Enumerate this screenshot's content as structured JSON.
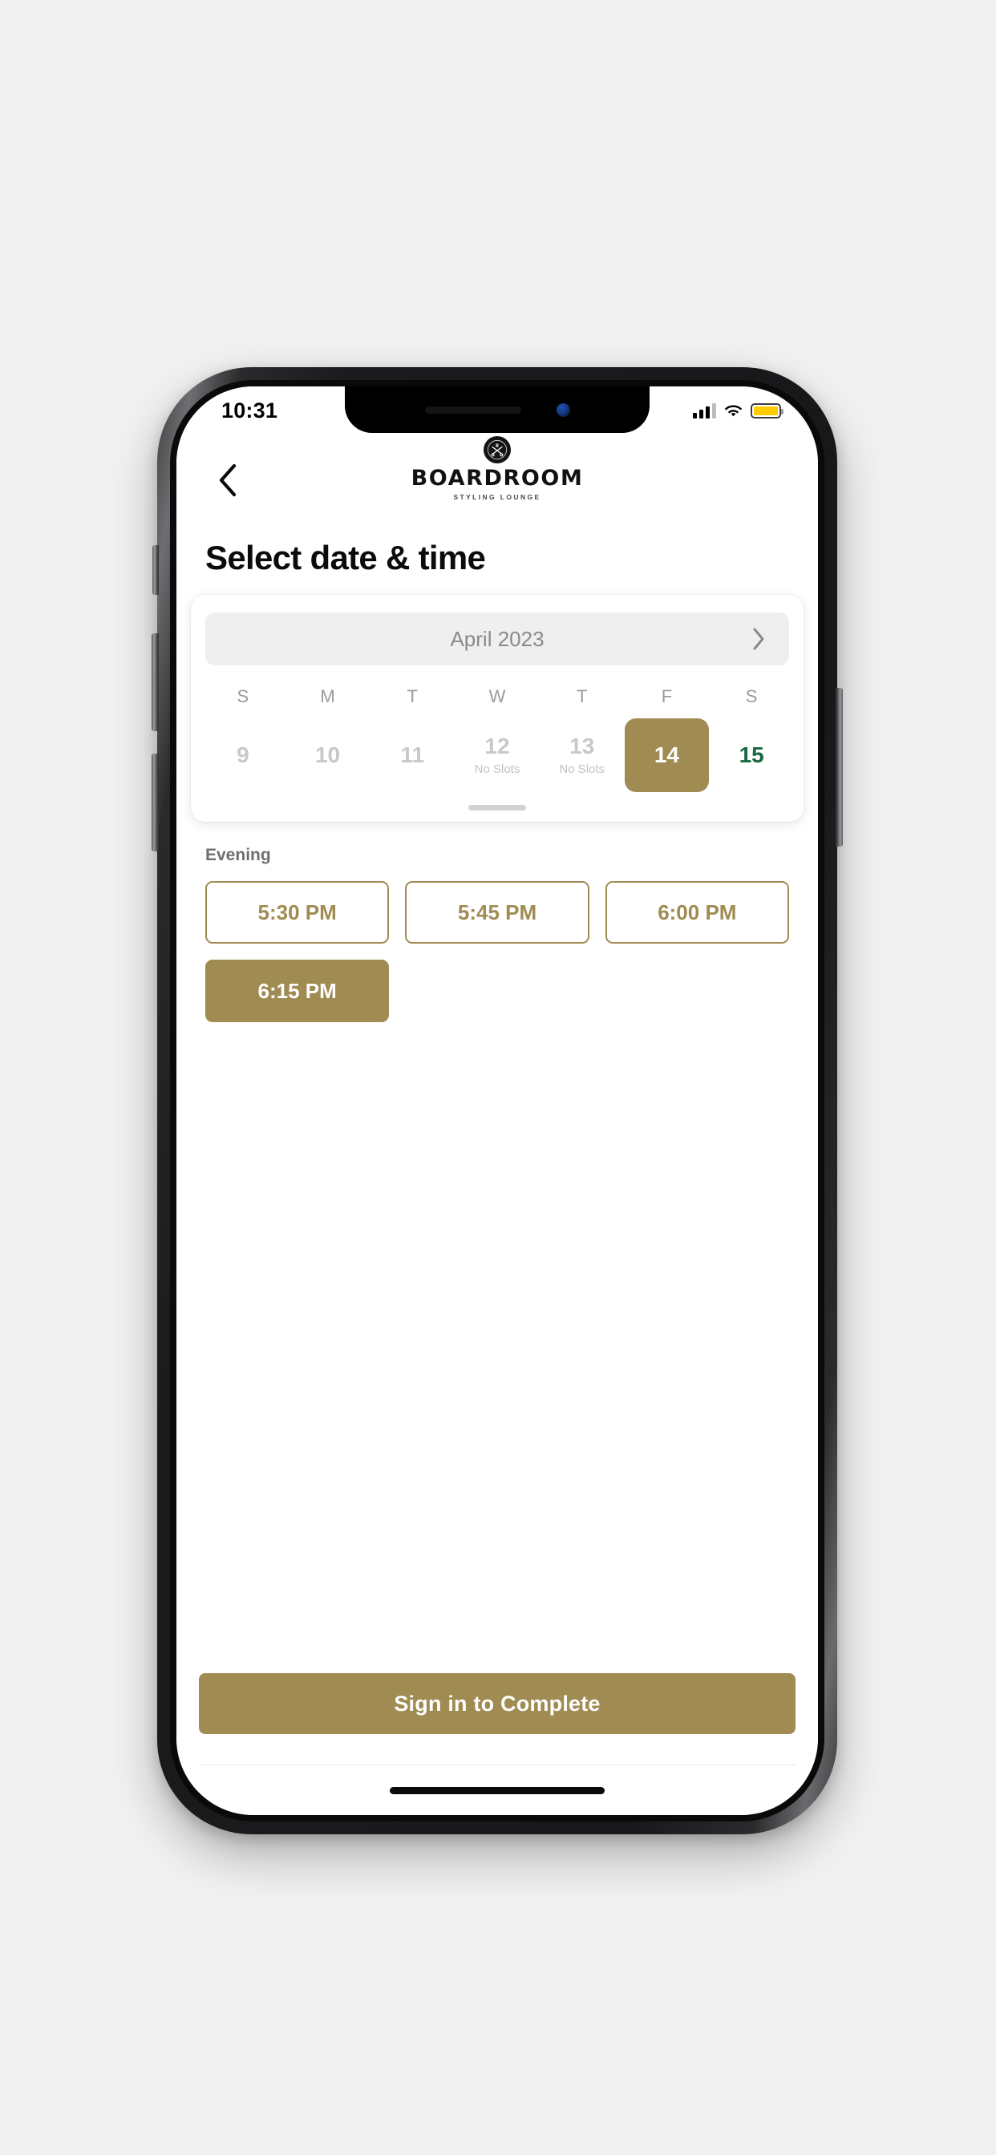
{
  "status_bar": {
    "time": "10:31",
    "signal_icon": "cellular-signal-icon",
    "wifi_icon": "wifi-icon",
    "battery_icon": "battery-icon",
    "battery_color": "#FFCC00"
  },
  "header": {
    "back_icon": "chevron-left-icon",
    "brand_badge_icon": "boardroom-emblem-icon",
    "brand_name": "BOARDROOM",
    "brand_tagline": "STYLING LOUNGE"
  },
  "page": {
    "title": "Select date & time",
    "accent_color": "#A08B52",
    "today_color": "#17693F"
  },
  "calendar": {
    "month_label": "April 2023",
    "next_month_icon": "chevron-right-icon",
    "drag_handle": "calendar-drag-handle",
    "weekday_headers": [
      "S",
      "M",
      "T",
      "W",
      "T",
      "F",
      "S"
    ],
    "days": [
      {
        "num": "9",
        "note": "",
        "state": "disabled"
      },
      {
        "num": "10",
        "note": "",
        "state": "disabled"
      },
      {
        "num": "11",
        "note": "",
        "state": "disabled"
      },
      {
        "num": "12",
        "note": "No Slots",
        "state": "no-slots"
      },
      {
        "num": "13",
        "note": "No Slots",
        "state": "no-slots"
      },
      {
        "num": "14",
        "note": "",
        "state": "selected"
      },
      {
        "num": "15",
        "note": "",
        "state": "today"
      }
    ]
  },
  "slots": {
    "heading": "Evening",
    "items": [
      {
        "label": "5:30 PM",
        "selected": false
      },
      {
        "label": "5:45 PM",
        "selected": false
      },
      {
        "label": "6:00 PM",
        "selected": false
      },
      {
        "label": "6:15 PM",
        "selected": true
      }
    ]
  },
  "footer": {
    "cta_label": "Sign in to Complete"
  }
}
